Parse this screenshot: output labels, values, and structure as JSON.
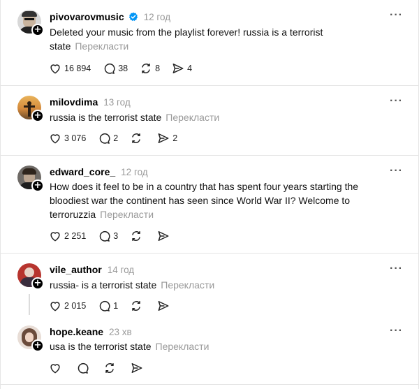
{
  "posts": [
    {
      "username": "pivovarovmusic",
      "verified": true,
      "time": "12 год",
      "text": "Deleted your music from the playlist forever! russia is a terrorist state",
      "translate": "Перекласти",
      "likes": "16 894",
      "comments": "38",
      "reposts": "8",
      "shares": "4"
    },
    {
      "username": "milovdima",
      "time": "13 год",
      "text": "russia is the terrorist state",
      "translate": "Перекласти",
      "likes": "3 076",
      "comments": "2",
      "reposts": "",
      "shares": "2"
    },
    {
      "username": "edward_core_",
      "time": "12 год",
      "text": "How does it feel to be in a country that has spent four years starting the bloodiest war the continent has seen since World War II? Welcome to terroruzzia",
      "translate": "Перекласти",
      "likes": "2 251",
      "comments": "3",
      "reposts": "",
      "shares": ""
    },
    {
      "username": "vile_author",
      "time": "14 год",
      "text": "russia- is a terrorist state",
      "translate": "Перекласти",
      "likes": "2 015",
      "comments": "1",
      "reposts": "",
      "shares": ""
    },
    {
      "username": "hope.keane",
      "time": "23 хв",
      "text": "usa is the terrorist state",
      "translate": "Перекласти",
      "likes": "",
      "comments": "",
      "reposts": "",
      "shares": ""
    }
  ],
  "icons": {
    "like": "heart-icon",
    "comment": "comment-icon",
    "repost": "repost-icon",
    "share": "share-icon",
    "more": "more-icon",
    "follow": "plus-icon",
    "verified": "verified-badge-icon"
  },
  "more_label": "···",
  "colors": {
    "verified": "#0095f6",
    "muted": "#999999"
  }
}
